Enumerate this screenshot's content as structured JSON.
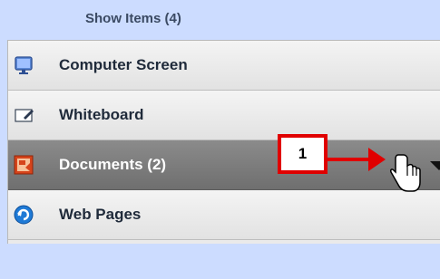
{
  "header": {
    "label": "Show Items (4)"
  },
  "items": [
    {
      "label": "Computer Screen",
      "icon": "monitor-icon",
      "selected": false
    },
    {
      "label": "Whiteboard",
      "icon": "whiteboard-icon",
      "selected": false
    },
    {
      "label": "Documents (2)",
      "icon": "document-icon",
      "selected": true
    },
    {
      "label": "Web Pages",
      "icon": "refresh-globe-icon",
      "selected": false
    }
  ],
  "annotation": {
    "number": "1"
  },
  "colors": {
    "header_bg": "#ccdcff",
    "callout_border": "#e00000",
    "selected_row": "#7d7d7d"
  }
}
